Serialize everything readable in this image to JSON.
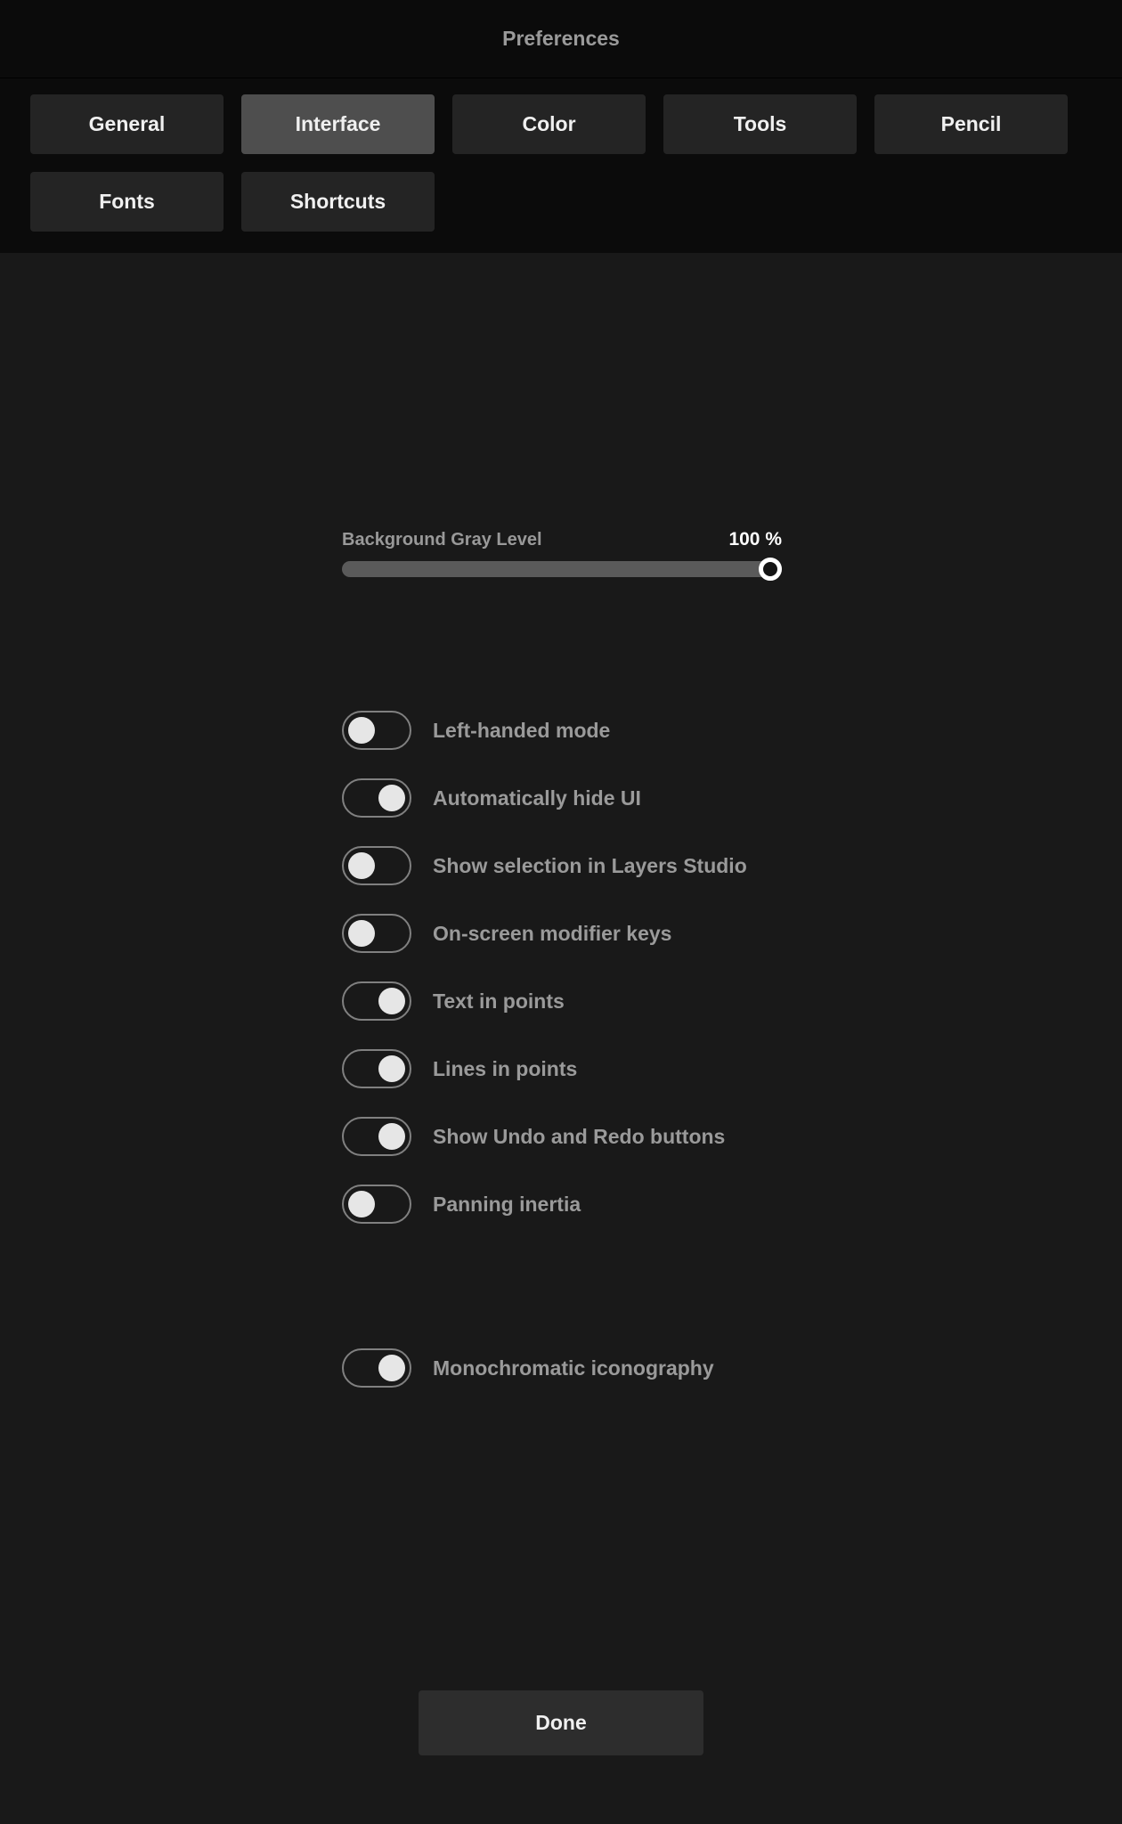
{
  "title": "Preferences",
  "tabs": [
    {
      "label": "General",
      "active": false
    },
    {
      "label": "Interface",
      "active": true
    },
    {
      "label": "Color",
      "active": false
    },
    {
      "label": "Tools",
      "active": false
    },
    {
      "label": "Pencil",
      "active": false
    },
    {
      "label": "Fonts",
      "active": false
    },
    {
      "label": "Shortcuts",
      "active": false
    }
  ],
  "slider": {
    "label": "Background Gray Level",
    "value": "100 %"
  },
  "toggles": [
    {
      "label": "Left-handed mode",
      "on": false
    },
    {
      "label": "Automatically hide UI",
      "on": true
    },
    {
      "label": "Show selection in Layers Studio",
      "on": false
    },
    {
      "label": "On-screen modifier keys",
      "on": false
    },
    {
      "label": "Text in points",
      "on": true
    },
    {
      "label": "Lines in points",
      "on": true
    },
    {
      "label": "Show Undo and Redo buttons",
      "on": true
    },
    {
      "label": "Panning inertia",
      "on": false
    }
  ],
  "separated_toggle": {
    "label": "Monochromatic iconography",
    "on": true
  },
  "done": "Done"
}
